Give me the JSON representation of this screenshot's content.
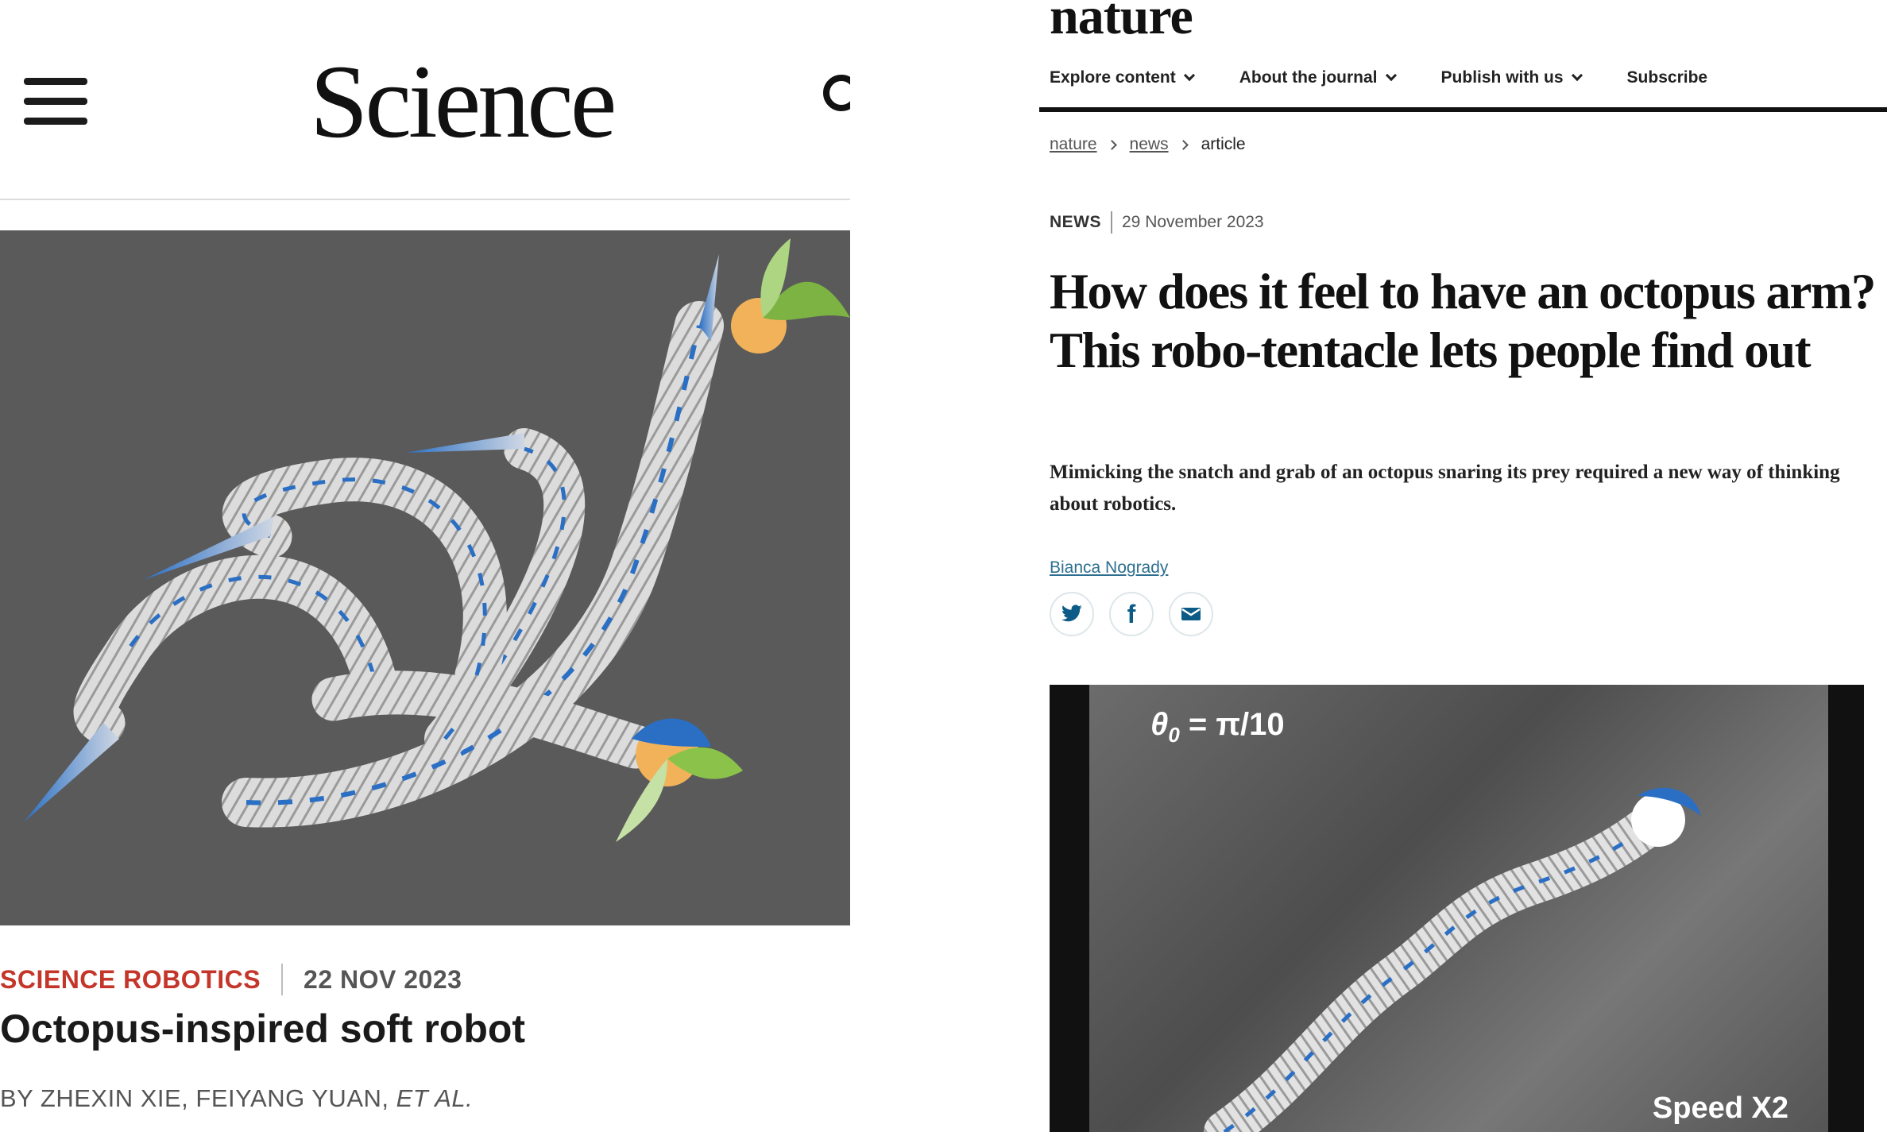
{
  "science": {
    "logo": "Science",
    "icons": {
      "menu": "hamburger-menu-icon",
      "search": "search-icon"
    },
    "figure": {
      "alt": "octopus-inspired soft robot arms",
      "bg_color": "#5a5a5a",
      "accent_color": "#2a6fc4"
    },
    "article": {
      "journal": "SCIENCE ROBOTICS",
      "date": "22 NOV 2023",
      "title": "Octopus-inspired soft robot",
      "byline_prefix": "BY",
      "authors": [
        "ZHEXIN XIE,",
        "FEIYANG YUAN,"
      ],
      "et_al": "ET AL."
    },
    "colors": {
      "journal": "#c4362a"
    }
  },
  "nature": {
    "logo": "nature",
    "nav": [
      {
        "label": "Explore content",
        "has_dropdown": true
      },
      {
        "label": "About the journal",
        "has_dropdown": true
      },
      {
        "label": "Publish with us",
        "has_dropdown": true
      },
      {
        "label": "Subscribe",
        "has_dropdown": false
      }
    ],
    "breadcrumb": [
      "nature",
      "news",
      "article"
    ],
    "article_type": "NEWS",
    "date": "29 November 2023",
    "title": "How does it feel to have an octopus arm? This robo-tentacle lets people find out",
    "standfirst": "Mimicking the snatch and grab of an octopus snaring its prey required a new way of thinking about robotics.",
    "author": "Bianca Nogrady",
    "share": [
      "twitter-icon",
      "facebook-icon",
      "email-icon"
    ],
    "video": {
      "theta_symbol": "θ",
      "theta_sub": "0",
      "theta_value": " = π/10",
      "speed_label": "Speed X2"
    },
    "colors": {
      "link": "#2c6e8f",
      "share_icon": "#0b5b86"
    }
  }
}
